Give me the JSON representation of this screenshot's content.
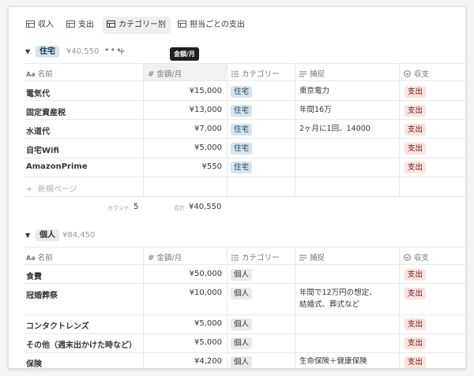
{
  "tabs": [
    {
      "label": "収入",
      "active": false
    },
    {
      "label": "支出",
      "active": false
    },
    {
      "label": "カテゴリー別",
      "active": true
    },
    {
      "label": "担当ごとの支出",
      "active": false
    }
  ],
  "columns": {
    "name": "名前",
    "amount": "金額/月",
    "category": "カテゴリー",
    "note": "捕捉",
    "type": "収支"
  },
  "tooltip": "金額/月",
  "groups": [
    {
      "tag": "住宅",
      "total": "¥40,550",
      "rows": [
        {
          "name": "電気代",
          "amount": "¥15,000",
          "category": "住宅",
          "note": "東京電力",
          "type": "支出"
        },
        {
          "name": "固定資産税",
          "amount": "¥13,000",
          "category": "住宅",
          "note": "年間16万",
          "type": "支出"
        },
        {
          "name": "水道代",
          "amount": "¥7,000",
          "category": "住宅",
          "note": "2ヶ月に1回、14000",
          "type": "支出"
        },
        {
          "name": "自宅Wifi",
          "amount": "¥5,000",
          "category": "住宅",
          "note": "",
          "type": "支出"
        },
        {
          "name": "AmazonPrime",
          "amount": "¥550",
          "category": "住宅",
          "note": "",
          "type": "支出"
        }
      ],
      "new_page": "新規ページ",
      "count_label": "カウント",
      "count_value": "5",
      "sum_label": "合計",
      "sum_value": "¥40,550"
    },
    {
      "tag": "個人",
      "total": "¥84,450",
      "rows": [
        {
          "name": "食費",
          "amount": "¥50,000",
          "category": "個人",
          "note": "",
          "type": "支出"
        },
        {
          "name": "冠婚葬祭",
          "amount": "¥10,000",
          "category": "個人",
          "note": "年間で12万円の想定、",
          "note2": "結婚式、葬式など",
          "type": "支出"
        },
        {
          "name": "コンタクトレンズ",
          "amount": "¥5,000",
          "category": "個人",
          "note": "",
          "type": "支出"
        },
        {
          "name": "その他（週末出かけた時など）",
          "amount": "¥5,000",
          "category": "個人",
          "note": "",
          "type": "支出"
        },
        {
          "name": "保険",
          "amount": "¥4,200",
          "category": "個人",
          "note": "生命保険＋健康保険",
          "type": "支出"
        }
      ]
    }
  ]
}
